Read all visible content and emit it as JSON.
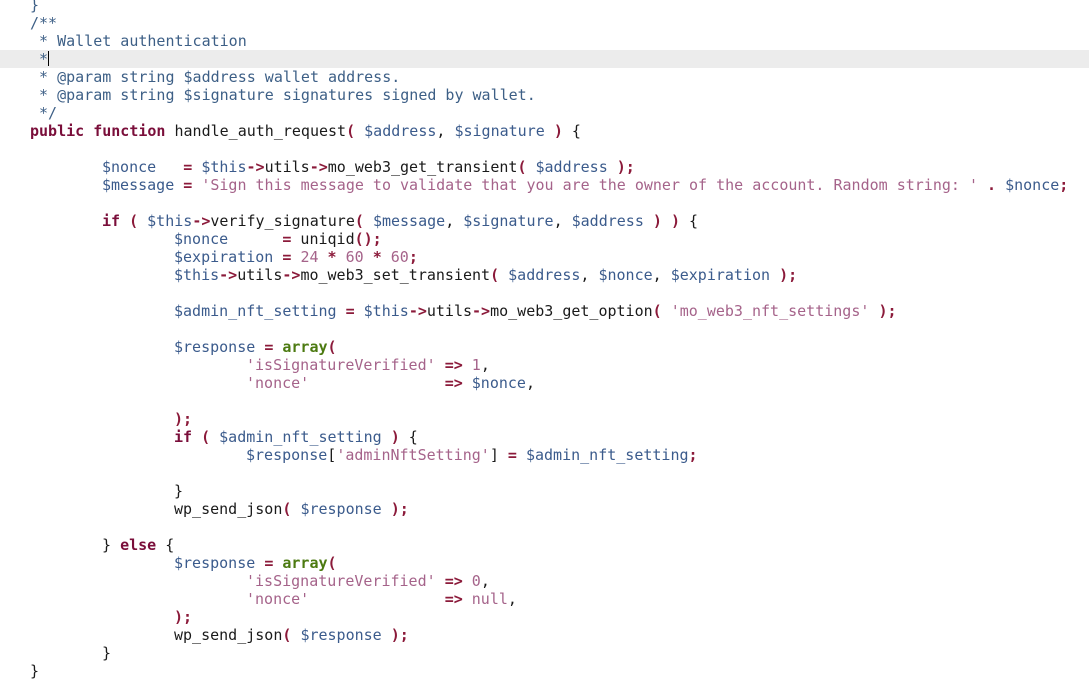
{
  "editor": {
    "cursor_line": 3,
    "lines": [
      {
        "indent": 0,
        "tokens": [
          [
            "cm",
            "}"
          ]
        ]
      },
      {
        "indent": 0,
        "tokens": [
          [
            "cm",
            "/**"
          ]
        ]
      },
      {
        "indent": 0,
        "tokens": [
          [
            "cm",
            " * Wallet authentication"
          ]
        ]
      },
      {
        "indent": 0,
        "tokens": [
          [
            "cm",
            " *"
          ]
        ],
        "caret": true
      },
      {
        "indent": 0,
        "tokens": [
          [
            "cm",
            " * @param string $address wallet address."
          ]
        ]
      },
      {
        "indent": 0,
        "tokens": [
          [
            "cm",
            " * @param string $signature signatures signed by wallet."
          ]
        ]
      },
      {
        "indent": 0,
        "tokens": [
          [
            "cm",
            " */"
          ]
        ]
      },
      {
        "indent": 0,
        "tokens": [
          [
            "kw",
            "public"
          ],
          [
            "plain",
            " "
          ],
          [
            "kw",
            "function"
          ],
          [
            "plain",
            " handle_auth_request"
          ],
          [
            "op",
            "("
          ],
          [
            "plain",
            " "
          ],
          [
            "var",
            "$address"
          ],
          [
            "plain",
            ", "
          ],
          [
            "var",
            "$signature"
          ],
          [
            "plain",
            " "
          ],
          [
            "op",
            ")"
          ],
          [
            "plain",
            " {"
          ]
        ]
      },
      {
        "indent": 0,
        "tokens": []
      },
      {
        "indent": 1,
        "tokens": [
          [
            "var",
            "$nonce"
          ],
          [
            "plain",
            "   "
          ],
          [
            "op",
            "="
          ],
          [
            "plain",
            " "
          ],
          [
            "var",
            "$this"
          ],
          [
            "op",
            "->"
          ],
          [
            "plain",
            "utils"
          ],
          [
            "op",
            "->"
          ],
          [
            "plain",
            "mo_web3_get_transient"
          ],
          [
            "op",
            "("
          ],
          [
            "plain",
            " "
          ],
          [
            "var",
            "$address"
          ],
          [
            "plain",
            " "
          ],
          [
            "op",
            ");"
          ]
        ]
      },
      {
        "indent": 1,
        "tokens": [
          [
            "var",
            "$message"
          ],
          [
            "plain",
            " "
          ],
          [
            "op",
            "="
          ],
          [
            "plain",
            " "
          ],
          [
            "str",
            "'Sign this message to validate that you are the owner of the account. Random string: '"
          ],
          [
            "plain",
            " "
          ],
          [
            "op",
            "."
          ],
          [
            "plain",
            " "
          ],
          [
            "var",
            "$nonce"
          ],
          [
            "op",
            ";"
          ]
        ]
      },
      {
        "indent": 0,
        "tokens": []
      },
      {
        "indent": 1,
        "tokens": [
          [
            "kw",
            "if"
          ],
          [
            "plain",
            " "
          ],
          [
            "op",
            "("
          ],
          [
            "plain",
            " "
          ],
          [
            "var",
            "$this"
          ],
          [
            "op",
            "->"
          ],
          [
            "plain",
            "verify_signature"
          ],
          [
            "op",
            "("
          ],
          [
            "plain",
            " "
          ],
          [
            "var",
            "$message"
          ],
          [
            "plain",
            ", "
          ],
          [
            "var",
            "$signature"
          ],
          [
            "plain",
            ", "
          ],
          [
            "var",
            "$address"
          ],
          [
            "plain",
            " "
          ],
          [
            "op",
            ")"
          ],
          [
            "plain",
            " "
          ],
          [
            "op",
            ")"
          ],
          [
            "plain",
            " {"
          ]
        ]
      },
      {
        "indent": 2,
        "tokens": [
          [
            "var",
            "$nonce"
          ],
          [
            "plain",
            "      "
          ],
          [
            "op",
            "="
          ],
          [
            "plain",
            " uniqid"
          ],
          [
            "op",
            "();"
          ]
        ]
      },
      {
        "indent": 2,
        "tokens": [
          [
            "var",
            "$expiration"
          ],
          [
            "plain",
            " "
          ],
          [
            "op",
            "="
          ],
          [
            "plain",
            " "
          ],
          [
            "num",
            "24"
          ],
          [
            "plain",
            " "
          ],
          [
            "op",
            "*"
          ],
          [
            "plain",
            " "
          ],
          [
            "num",
            "60"
          ],
          [
            "plain",
            " "
          ],
          [
            "op",
            "*"
          ],
          [
            "plain",
            " "
          ],
          [
            "num",
            "60"
          ],
          [
            "op",
            ";"
          ]
        ]
      },
      {
        "indent": 2,
        "tokens": [
          [
            "var",
            "$this"
          ],
          [
            "op",
            "->"
          ],
          [
            "plain",
            "utils"
          ],
          [
            "op",
            "->"
          ],
          [
            "plain",
            "mo_web3_set_transient"
          ],
          [
            "op",
            "("
          ],
          [
            "plain",
            " "
          ],
          [
            "var",
            "$address"
          ],
          [
            "plain",
            ", "
          ],
          [
            "var",
            "$nonce"
          ],
          [
            "plain",
            ", "
          ],
          [
            "var",
            "$expiration"
          ],
          [
            "plain",
            " "
          ],
          [
            "op",
            ");"
          ]
        ]
      },
      {
        "indent": 0,
        "tokens": []
      },
      {
        "indent": 2,
        "tokens": [
          [
            "var",
            "$admin_nft_setting"
          ],
          [
            "plain",
            " "
          ],
          [
            "op",
            "="
          ],
          [
            "plain",
            " "
          ],
          [
            "var",
            "$this"
          ],
          [
            "op",
            "->"
          ],
          [
            "plain",
            "utils"
          ],
          [
            "op",
            "->"
          ],
          [
            "plain",
            "mo_web3_get_option"
          ],
          [
            "op",
            "("
          ],
          [
            "plain",
            " "
          ],
          [
            "str",
            "'mo_web3_nft_settings'"
          ],
          [
            "plain",
            " "
          ],
          [
            "op",
            ");"
          ]
        ]
      },
      {
        "indent": 0,
        "tokens": []
      },
      {
        "indent": 2,
        "tokens": [
          [
            "var",
            "$response"
          ],
          [
            "plain",
            " "
          ],
          [
            "op",
            "="
          ],
          [
            "plain",
            " "
          ],
          [
            "arr",
            "array"
          ],
          [
            "op",
            "("
          ]
        ]
      },
      {
        "indent": 3,
        "tokens": [
          [
            "str",
            "'isSignatureVerified'"
          ],
          [
            "plain",
            " "
          ],
          [
            "op",
            "=>"
          ],
          [
            "plain",
            " "
          ],
          [
            "num",
            "1"
          ],
          [
            "plain",
            ","
          ]
        ]
      },
      {
        "indent": 3,
        "tokens": [
          [
            "str",
            "'nonce'"
          ],
          [
            "plain",
            "               "
          ],
          [
            "op",
            "=>"
          ],
          [
            "plain",
            " "
          ],
          [
            "var",
            "$nonce"
          ],
          [
            "plain",
            ","
          ]
        ]
      },
      {
        "indent": 0,
        "tokens": []
      },
      {
        "indent": 2,
        "tokens": [
          [
            "op",
            ");"
          ]
        ]
      },
      {
        "indent": 2,
        "tokens": [
          [
            "kw",
            "if"
          ],
          [
            "plain",
            " "
          ],
          [
            "op",
            "("
          ],
          [
            "plain",
            " "
          ],
          [
            "var",
            "$admin_nft_setting"
          ],
          [
            "plain",
            " "
          ],
          [
            "op",
            ")"
          ],
          [
            "plain",
            " {"
          ]
        ]
      },
      {
        "indent": 3,
        "tokens": [
          [
            "var",
            "$response"
          ],
          [
            "plain",
            "["
          ],
          [
            "str",
            "'adminNftSetting'"
          ],
          [
            "plain",
            "] "
          ],
          [
            "op",
            "="
          ],
          [
            "plain",
            " "
          ],
          [
            "var",
            "$admin_nft_setting"
          ],
          [
            "op",
            ";"
          ]
        ]
      },
      {
        "indent": 0,
        "tokens": []
      },
      {
        "indent": 2,
        "tokens": [
          [
            "plain",
            "}"
          ]
        ]
      },
      {
        "indent": 2,
        "tokens": [
          [
            "plain",
            "wp_send_json"
          ],
          [
            "op",
            "("
          ],
          [
            "plain",
            " "
          ],
          [
            "var",
            "$response"
          ],
          [
            "plain",
            " "
          ],
          [
            "op",
            ");"
          ]
        ]
      },
      {
        "indent": 0,
        "tokens": []
      },
      {
        "indent": 1,
        "tokens": [
          [
            "plain",
            "} "
          ],
          [
            "kw",
            "else"
          ],
          [
            "plain",
            " {"
          ]
        ]
      },
      {
        "indent": 2,
        "tokens": [
          [
            "var",
            "$response"
          ],
          [
            "plain",
            " "
          ],
          [
            "op",
            "="
          ],
          [
            "plain",
            " "
          ],
          [
            "arr",
            "array"
          ],
          [
            "op",
            "("
          ]
        ]
      },
      {
        "indent": 3,
        "tokens": [
          [
            "str",
            "'isSignatureVerified'"
          ],
          [
            "plain",
            " "
          ],
          [
            "op",
            "=>"
          ],
          [
            "plain",
            " "
          ],
          [
            "num",
            "0"
          ],
          [
            "plain",
            ","
          ]
        ]
      },
      {
        "indent": 3,
        "tokens": [
          [
            "str",
            "'nonce'"
          ],
          [
            "plain",
            "               "
          ],
          [
            "op",
            "=>"
          ],
          [
            "plain",
            " "
          ],
          [
            "num",
            "null"
          ],
          [
            "plain",
            ","
          ]
        ]
      },
      {
        "indent": 2,
        "tokens": [
          [
            "op",
            ");"
          ]
        ]
      },
      {
        "indent": 2,
        "tokens": [
          [
            "plain",
            "wp_send_json"
          ],
          [
            "op",
            "("
          ],
          [
            "plain",
            " "
          ],
          [
            "var",
            "$response"
          ],
          [
            "plain",
            " "
          ],
          [
            "op",
            ");"
          ]
        ]
      },
      {
        "indent": 1,
        "tokens": [
          [
            "plain",
            "}"
          ]
        ]
      },
      {
        "indent": 0,
        "tokens": [
          [
            "plain",
            "}"
          ]
        ]
      }
    ]
  }
}
